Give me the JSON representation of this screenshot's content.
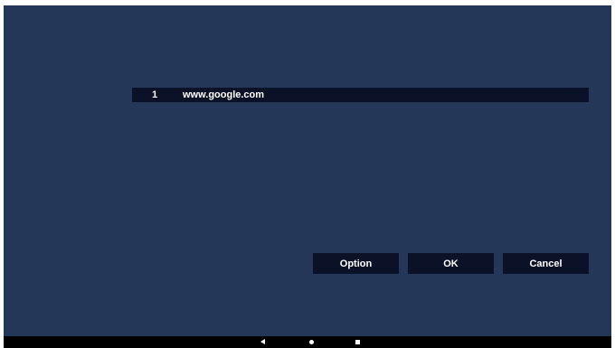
{
  "playlist": {
    "items": [
      {
        "index": "1",
        "url": "www.google.com"
      }
    ]
  },
  "buttons": {
    "option_label": "Option",
    "ok_label": "OK",
    "cancel_label": "Cancel"
  },
  "navbar": {
    "back_icon": "back-triangle",
    "home_icon": "home-circle",
    "recents_icon": "recents-square"
  },
  "colors": {
    "background": "#243758",
    "button_bg": "#0b1227",
    "navbar_bg": "#000000",
    "text": "#ffffff"
  }
}
